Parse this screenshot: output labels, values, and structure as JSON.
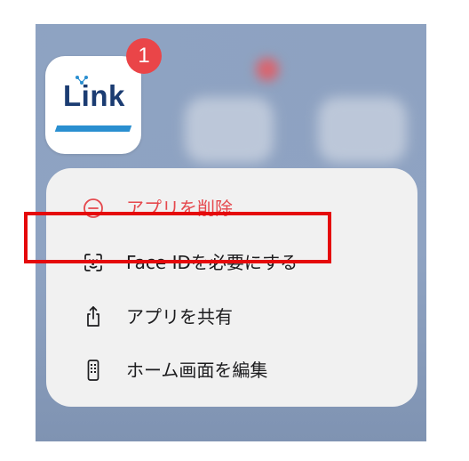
{
  "app": {
    "name": "Link",
    "badge_count": "1"
  },
  "context_menu": {
    "items": [
      {
        "label": "アプリを削除",
        "icon": "minus-circle-icon",
        "destructive": true
      },
      {
        "label": "Face IDを必要にする",
        "icon": "face-id-icon",
        "destructive": false
      },
      {
        "label": "アプリを共有",
        "icon": "share-icon",
        "destructive": false
      },
      {
        "label": "ホーム画面を編集",
        "icon": "phone-icon",
        "destructive": false
      }
    ]
  },
  "colors": {
    "destructive": "#e5484d",
    "highlight_border": "#e5090b",
    "badge": "#ea4548",
    "logo_text": "#1b3c72",
    "logo_stripe": "#2a8fd0"
  }
}
